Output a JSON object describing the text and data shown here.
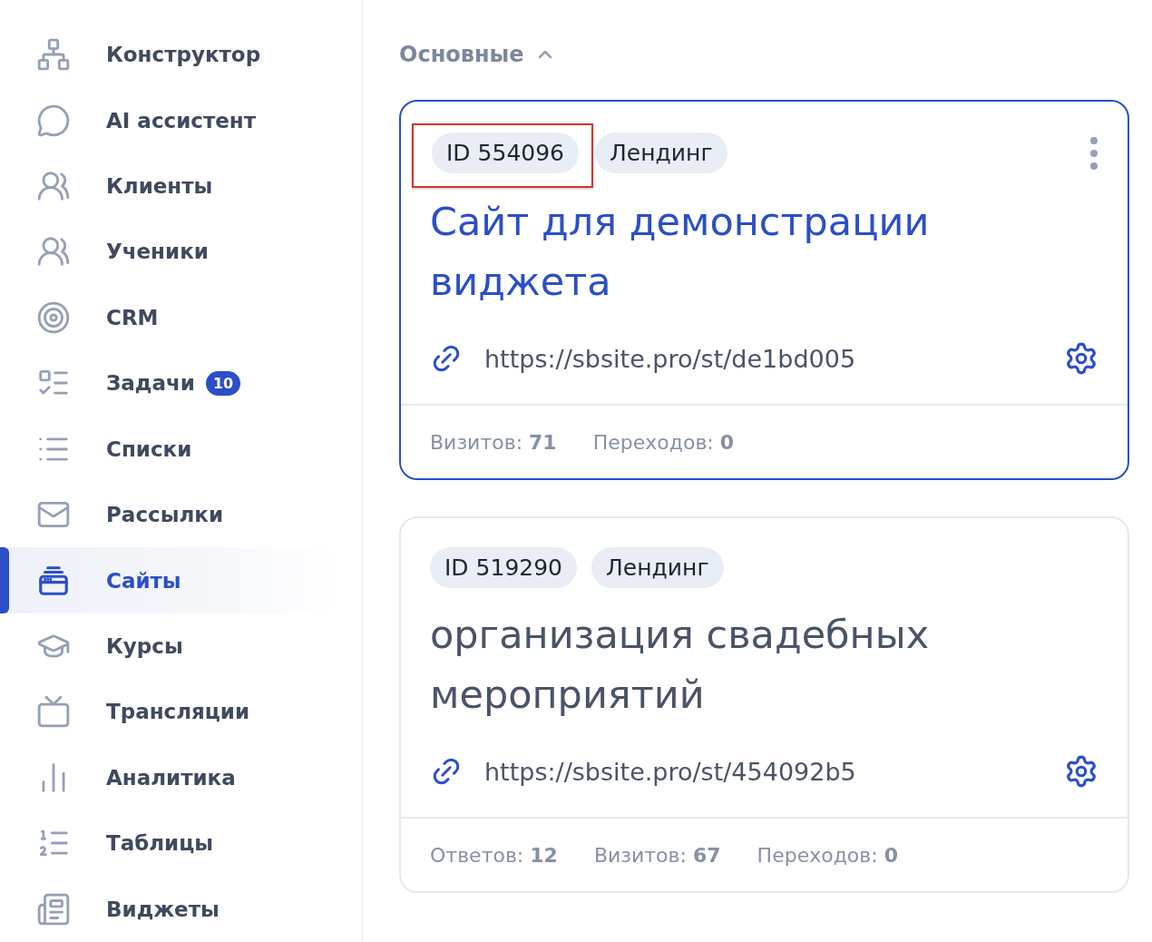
{
  "sidebar": {
    "items": [
      {
        "label": "Конструктор",
        "selected": false
      },
      {
        "label": "AI ассистент",
        "selected": false
      },
      {
        "label": "Клиенты",
        "selected": false
      },
      {
        "label": "Ученики",
        "selected": false
      },
      {
        "label": "CRM",
        "selected": false
      },
      {
        "label": "Задачи",
        "selected": false,
        "badge": "10"
      },
      {
        "label": "Списки",
        "selected": false
      },
      {
        "label": "Рассылки",
        "selected": false
      },
      {
        "label": "Сайты",
        "selected": true
      },
      {
        "label": "Курсы",
        "selected": false
      },
      {
        "label": "Трансляции",
        "selected": false
      },
      {
        "label": "Аналитика",
        "selected": false
      },
      {
        "label": "Таблицы",
        "selected": false
      },
      {
        "label": "Виджеты",
        "selected": false
      }
    ]
  },
  "section": {
    "title": "Основные",
    "expanded": true
  },
  "cards": [
    {
      "id": "ID 554096",
      "type": "Лендинг",
      "title": "Сайт для демонстрации виджета",
      "url": "https://sbsite.pro/st/de1bd005",
      "selected": true,
      "id_highlighted": true,
      "menu": true,
      "stats": [
        {
          "label": "Визитов:",
          "value": "71"
        },
        {
          "label": "Переходов:",
          "value": "0"
        }
      ]
    },
    {
      "id": "ID 519290",
      "type": "Лендинг",
      "title": "организация свадебных мероприятий",
      "url": "https://sbsite.pro/st/454092b5",
      "selected": false,
      "id_highlighted": false,
      "menu": false,
      "stats": [
        {
          "label": "Ответов:",
          "value": "12"
        },
        {
          "label": "Визитов:",
          "value": "67"
        },
        {
          "label": "Переходов:",
          "value": "0"
        }
      ]
    }
  ]
}
